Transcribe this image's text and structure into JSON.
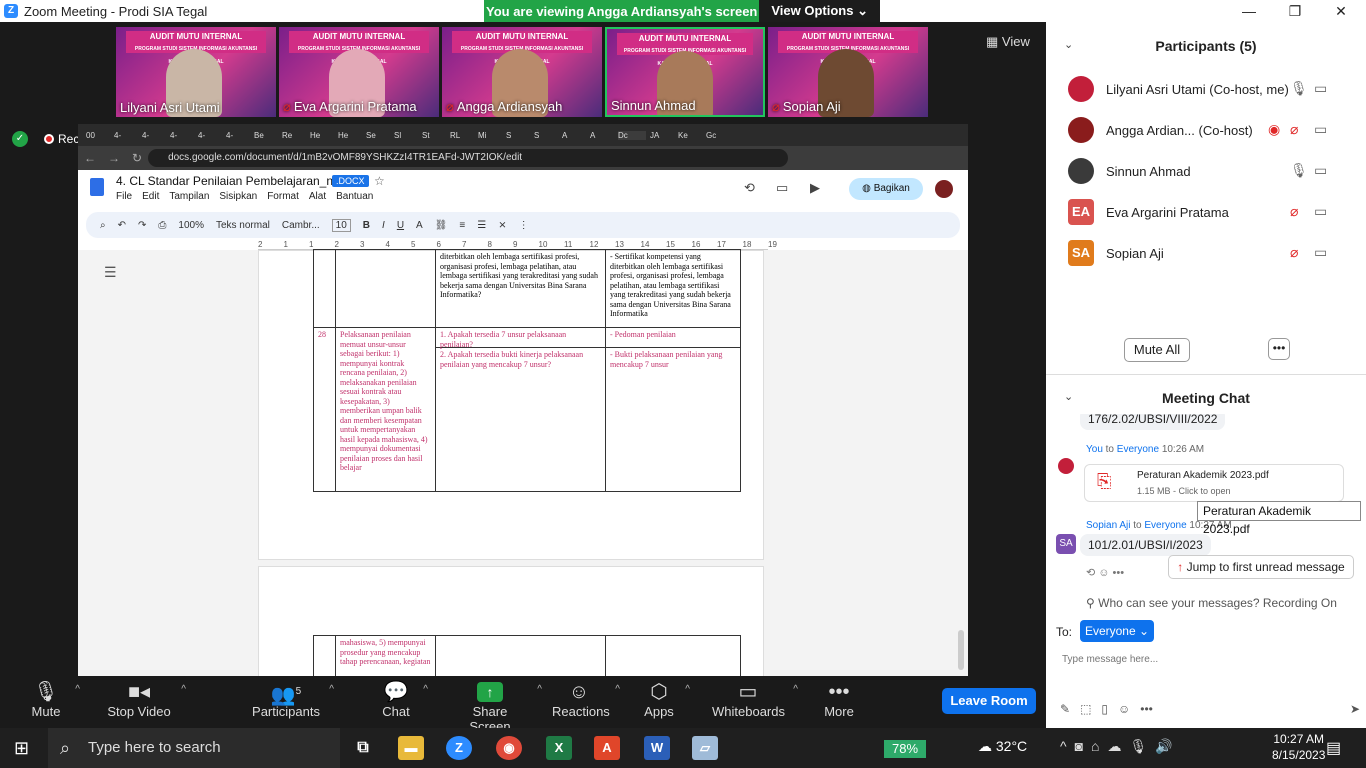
{
  "window": {
    "title": "Zoom Meeting - Prodi SIA Tegal",
    "minimize": "—",
    "restore": "❐",
    "close": "✕"
  },
  "banner": {
    "text": "You are viewing Angga Ardiansyah's screen",
    "view_options": "View Options"
  },
  "view_button": "View",
  "recording_label": "Recording",
  "tiles": [
    {
      "name": "Lilyani Asri Utami",
      "muted": false
    },
    {
      "name": "Eva Argarini Pratama",
      "muted": true
    },
    {
      "name": "Angga Ardiansyah",
      "muted": true
    },
    {
      "name": "Sinnun Ahmad",
      "muted": false
    },
    {
      "name": "Sopian Aji",
      "muted": true
    }
  ],
  "tile_banner_text": "AUDIT MUTU INTERNAL",
  "tile_banner_sub": "PROGRAM STUDI SISTEM INFORMASI AKUNTANSI KAMPUS KOTA TEGAL",
  "browser": {
    "tabs": [
      "00",
      "4-",
      "4-",
      "4-",
      "4-",
      "4-",
      "Be",
      "Re",
      "He",
      "He",
      "Se",
      "Sl",
      "St",
      "RL",
      "Mi",
      "S",
      "S",
      "A",
      "A",
      "Dc",
      "JA",
      "Ke",
      "Gc"
    ],
    "url": "docs.google.com/document/d/1mB2vOMF89YSHKZzI4TR1EAFd-JWT2IOK/edit"
  },
  "doc": {
    "title": "4. CL Standar Penilaian Pembelajaran_new",
    "format_badge": ".DOCX",
    "menus": [
      "File",
      "Edit",
      "Tampilan",
      "Sisipkan",
      "Format",
      "Alat",
      "Bantuan"
    ],
    "share_label": "Bagikan",
    "zoom": "100%",
    "style": "Teks normal",
    "font": "Cambr...",
    "font_size": "10",
    "ruler": [
      "2",
      "1",
      "1",
      "2",
      "3",
      "4",
      "5",
      "6",
      "7",
      "8",
      "9",
      "10",
      "11",
      "12",
      "13",
      "14",
      "15",
      "16",
      "17",
      "18",
      "19"
    ]
  },
  "table_top": {
    "col3": "diterbitkan oleh lembaga sertifikasi profesi, organisasi profesi, lembaga pelatihan, atau lembaga sertifikasi yang terakreditasi yang sudah bekerja sama dengan Universitas Bina Sarana Informatika?",
    "col4": "Sertifikat kompetensi yang diterbitkan oleh lembaga sertifikasi profesi, organisasi profesi, lembaga pelatihan, atau lembaga sertifikasi yang terakreditasi yang sudah bekerja sama dengan Universitas Bina Sarana Informatika"
  },
  "row28": {
    "num": "28",
    "desc": "Pelaksanaan penilaian memuat unsur-unsur sebagai berikut: 1) mempunyai kontrak rencana penilaian, 2) melaksanakan penilaian sesuai kontrak atau kesepakatan, 3) memberikan umpan balik dan memberi kesempatan untuk mempertanyakan hasil kepada mahasiswa, 4) mempunyai dokumentasi penilaian proses dan hasil belajar",
    "q1_num": "1.",
    "q1": "Apakah tersedia 7 unsur pelaksanaan penilaian?",
    "q2_num": "2.",
    "q2": "Apakah tersedia bukti kinerja pelaksanaan penilaian yang mencakup 7 unsur?",
    "e1": "Pedoman penilaian",
    "e2": "Bukti pelaksanaan penilaian yang mencakup 7 unsur"
  },
  "page2_desc": "mahasiswa, 5) mempunyai prosedur yang mencakup tahap perencanaan, kegiatan",
  "zoombar": {
    "mute": "Mute",
    "stop_video": "Stop Video",
    "participants": "Participants",
    "participant_count": "5",
    "chat": "Chat",
    "share_screen": "Share Screen",
    "reactions": "Reactions",
    "apps": "Apps",
    "whiteboards": "Whiteboards",
    "more": "More",
    "leave": "Leave Room"
  },
  "panel": {
    "participants_title": "Participants (5)",
    "participants": [
      {
        "name": "Lilyani Asri Utami (Co-host, me)",
        "initials": "",
        "color": "#c21f3a"
      },
      {
        "name": "Angga Ardian... (Co-host)",
        "initials": "",
        "color": "#8a1c1c"
      },
      {
        "name": "Sinnun Ahmad",
        "initials": "",
        "color": "#3a3a3a"
      },
      {
        "name": "Eva Argarini Pratama",
        "initials": "EA",
        "color": "#d9534f"
      },
      {
        "name": "Sopian Aji",
        "initials": "SA",
        "color": "#e07b1c"
      }
    ],
    "mute_all": "Mute All",
    "chat_title": "Meeting Chat",
    "prev_msg": "176/2.02/UBSI/VIII/2022",
    "msg1_from": "You",
    "msg1_to_word": "to",
    "msg1_to": "Everyone",
    "msg1_time": "10:26 AM",
    "file_name": "Peraturan Akademik 2023.pdf",
    "file_meta": "1.15 MB - Click to open",
    "tooltip": "Peraturan Akademik 2023.pdf",
    "msg2_from": "Sopian Aji",
    "msg2_to_word": "to",
    "msg2_to": "Everyone",
    "msg2_time": "10:27 AM",
    "msg2_text": "101/2.01/UBSI/I/2023",
    "jump": "Jump to first unread message",
    "who_can_see": "Who can see your messages? Recording On",
    "to_label": "To:",
    "to_value": "Everyone",
    "input_placeholder": "Type message here..."
  },
  "taskbar": {
    "search_placeholder": "Type here to search",
    "battery": "78%",
    "temperature": "32°C",
    "time": "10:27 AM",
    "date": "8/15/2023"
  }
}
